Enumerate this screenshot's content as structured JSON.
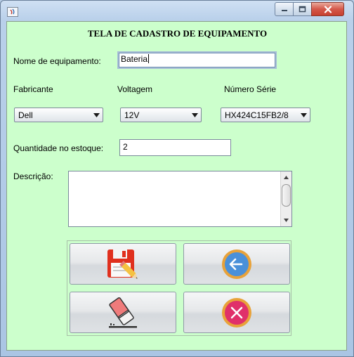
{
  "window": {
    "title": "",
    "controls": {
      "minimize": "minimize-icon",
      "maximize": "maximize-icon",
      "close": "close-icon"
    }
  },
  "form": {
    "heading": "TELA DE CADASTRO DE EQUIPAMENTO",
    "nome": {
      "label": "Nome de equipamento:",
      "value": "Bateria"
    },
    "fabricante": {
      "label": "Fabricante",
      "selected": "Dell"
    },
    "voltagem": {
      "label": "Voltagem",
      "selected": "12V"
    },
    "numero_serie": {
      "label": "Número Série",
      "selected": "HX424C15FB2/8"
    },
    "quantidade": {
      "label": "Quantidade no estoque:",
      "value": "2"
    },
    "descricao": {
      "label": "Descrição:",
      "value": ""
    }
  },
  "buttons": {
    "save": {
      "icon": "floppy-disk-pencil-icon"
    },
    "back": {
      "icon": "back-arrow-icon"
    },
    "clear": {
      "icon": "eraser-icon"
    },
    "cancel": {
      "icon": "cancel-x-icon"
    }
  },
  "colors": {
    "form_background": "#ccffcc",
    "save_icon_red": "#e0301e",
    "back_icon_blue": "#4a90d9",
    "cancel_icon_pink": "#e0306a"
  }
}
